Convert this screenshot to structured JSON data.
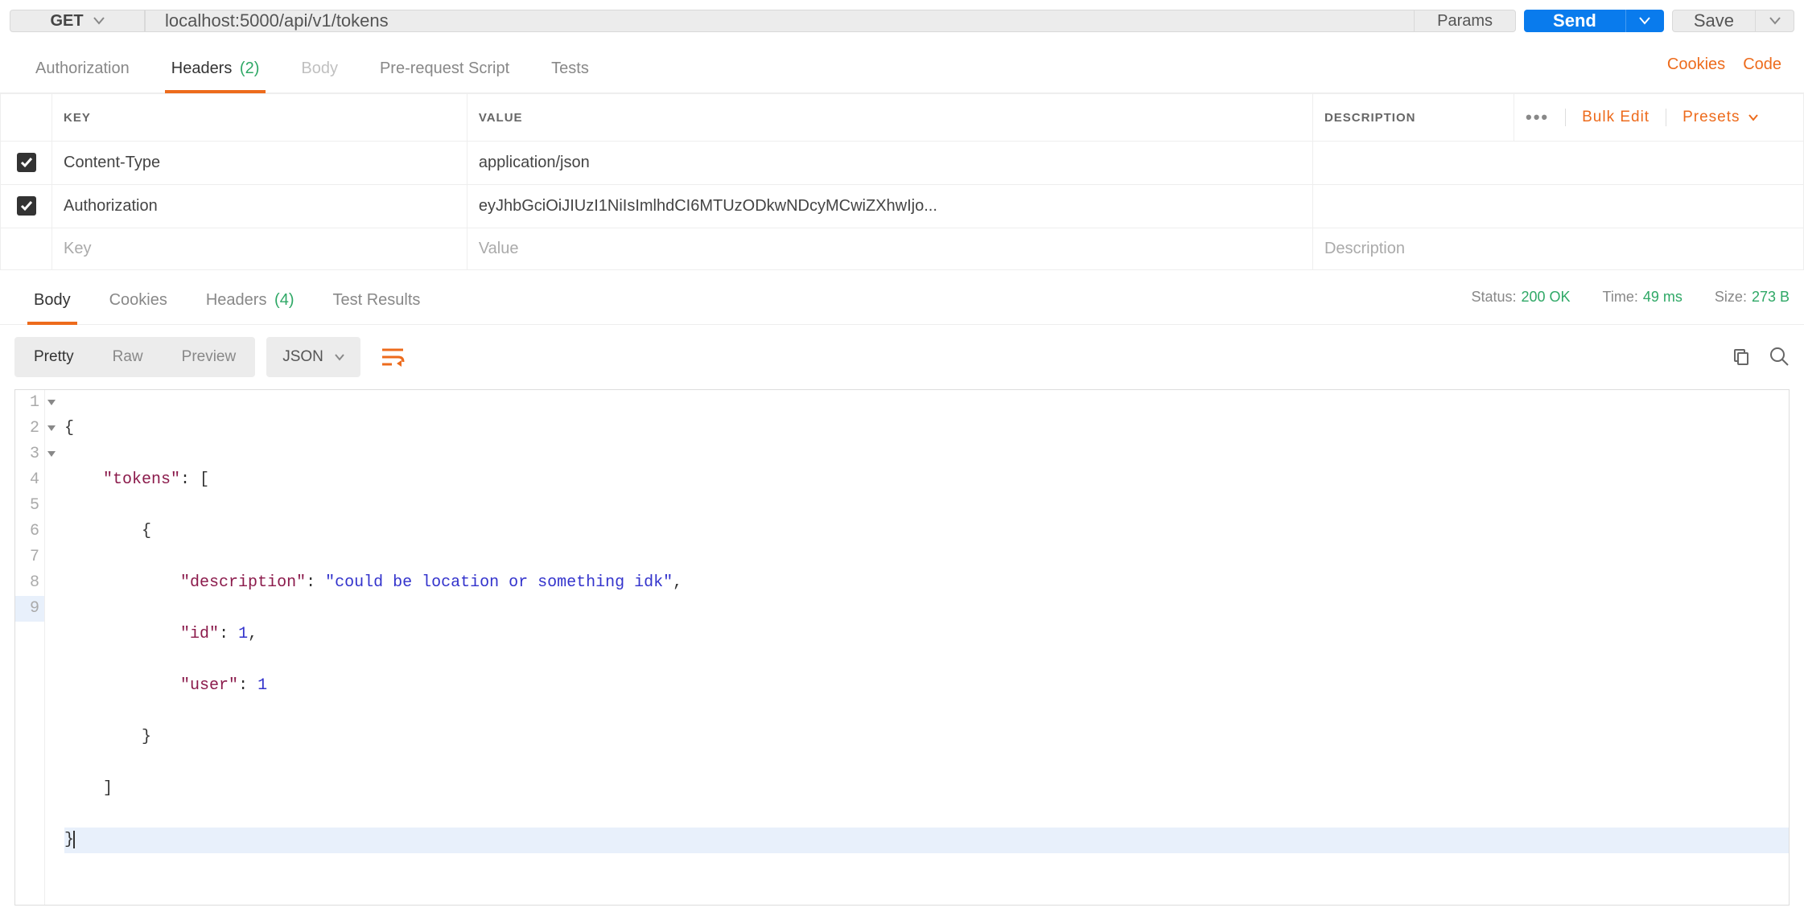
{
  "request": {
    "method": "GET",
    "url": "localhost:5000/api/v1/tokens",
    "params_label": "Params",
    "send_label": "Send",
    "save_label": "Save"
  },
  "req_tabs": {
    "authorization": "Authorization",
    "headers": "Headers",
    "headers_count": "(2)",
    "body": "Body",
    "prerequest": "Pre-request Script",
    "tests": "Tests",
    "cookies_link": "Cookies",
    "code_link": "Code"
  },
  "headers_table": {
    "col_key": "KEY",
    "col_value": "VALUE",
    "col_desc": "DESCRIPTION",
    "bulk_edit": "Bulk Edit",
    "presets": "Presets",
    "rows": [
      {
        "key": "Content-Type",
        "value": "application/json",
        "desc": ""
      },
      {
        "key": "Authorization",
        "value": "eyJhbGciOiJIUzI1NiIsImlhdCI6MTUzODkwNDcyMCwiZXhwIjo...",
        "desc": ""
      }
    ],
    "ph_key": "Key",
    "ph_value": "Value",
    "ph_desc": "Description"
  },
  "resp_tabs": {
    "body": "Body",
    "cookies": "Cookies",
    "headers": "Headers",
    "headers_count": "(4)",
    "tests": "Test Results"
  },
  "resp_meta": {
    "status_label": "Status:",
    "status_value": "200 OK",
    "time_label": "Time:",
    "time_value": "49 ms",
    "size_label": "Size:",
    "size_value": "273 B"
  },
  "body_toolbar": {
    "pretty": "Pretty",
    "raw": "Raw",
    "preview": "Preview",
    "format": "JSON"
  },
  "response_body": {
    "lines": [
      "{",
      "    \"tokens\": [",
      "        {",
      "            \"description\": \"could be location or something idk\",",
      "            \"id\": 1,",
      "            \"user\": 1",
      "        }",
      "    ]",
      "}"
    ]
  }
}
